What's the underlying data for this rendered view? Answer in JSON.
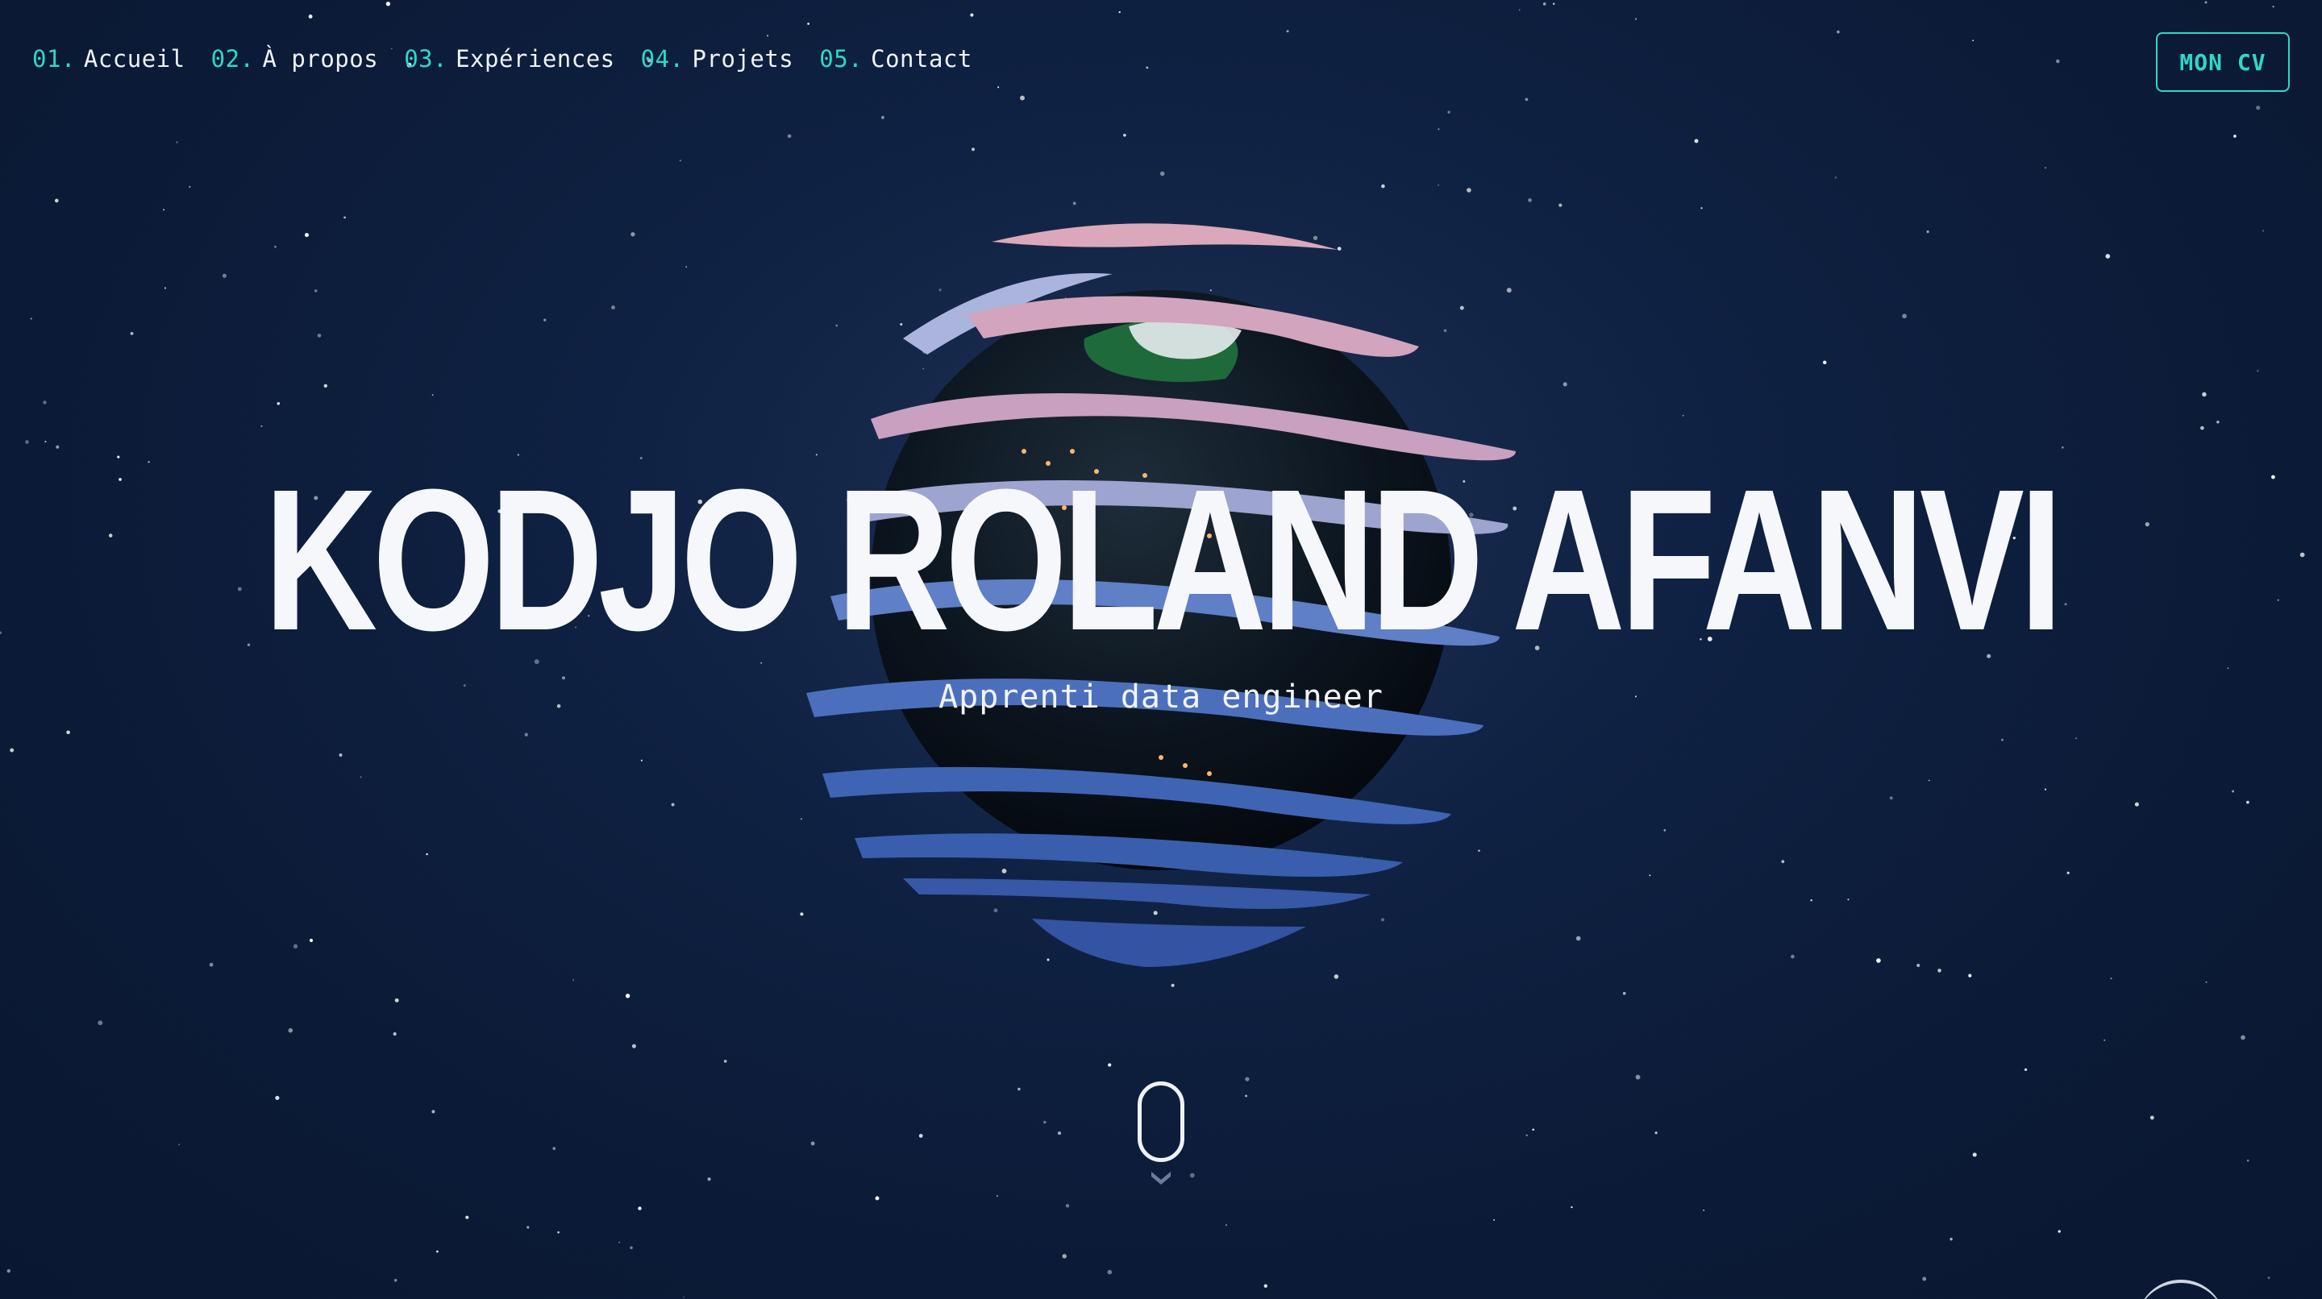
{
  "nav": {
    "items": [
      {
        "num": "01.",
        "label": "Accueil"
      },
      {
        "num": "02.",
        "label": "À propos"
      },
      {
        "num": "03.",
        "label": "Expériences"
      },
      {
        "num": "04.",
        "label": "Projets"
      },
      {
        "num": "05.",
        "label": "Contact"
      }
    ]
  },
  "cv_button": {
    "label": "MON CV"
  },
  "hero": {
    "name": "KODJO ROLAND AFANVI",
    "subtitle": "Apprenti data engineer"
  },
  "icons": {
    "scroll": "mouse-scroll-icon",
    "arrow": "chevron-down-icon",
    "globe": "globe-illustration"
  },
  "colors": {
    "background": "#0b1a36",
    "accent": "#2fd8c6",
    "text": "#eef1f6",
    "ribbon_blue": "#3f64b4",
    "ribbon_pink": "#d7a0b4"
  }
}
